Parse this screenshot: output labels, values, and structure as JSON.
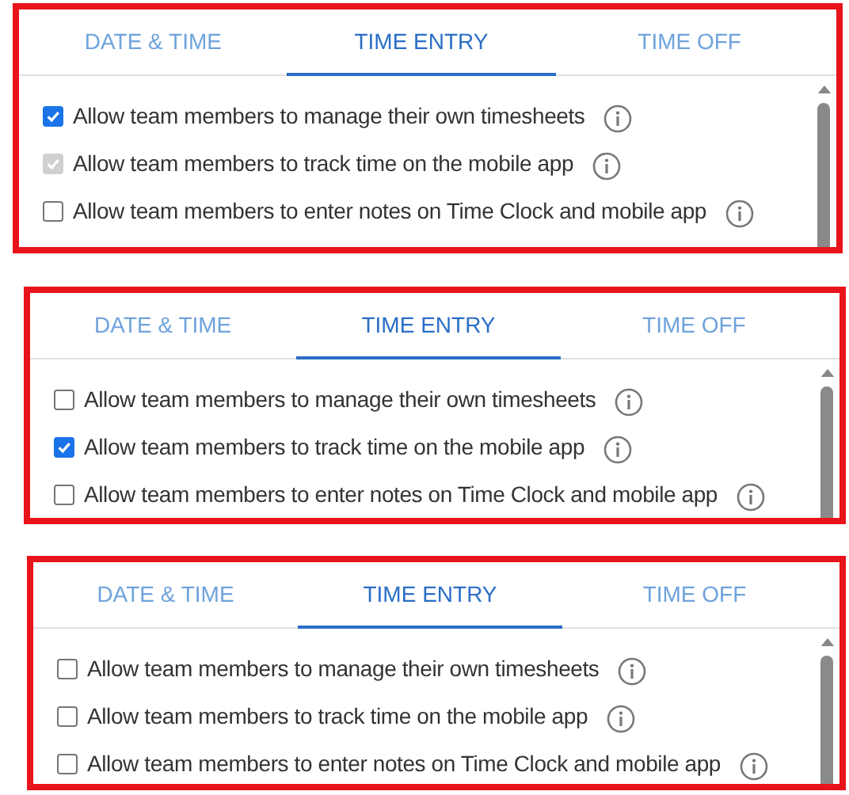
{
  "panels": [
    {
      "tabs": [
        {
          "label": "DATE & TIME",
          "selected": false
        },
        {
          "label": "TIME ENTRY",
          "selected": true
        },
        {
          "label": "TIME OFF",
          "selected": false
        }
      ],
      "options": [
        {
          "label": "Allow team members to manage their own timesheets",
          "checked": true,
          "disabled": false
        },
        {
          "label": "Allow team members to track time on the mobile app",
          "checked": true,
          "disabled": true
        },
        {
          "label": "Allow team members to enter notes on Time Clock and mobile app",
          "checked": false,
          "disabled": false
        }
      ]
    },
    {
      "tabs": [
        {
          "label": "DATE & TIME",
          "selected": false
        },
        {
          "label": "TIME ENTRY",
          "selected": true
        },
        {
          "label": "TIME OFF",
          "selected": false
        }
      ],
      "options": [
        {
          "label": "Allow team members to manage their own timesheets",
          "checked": false,
          "disabled": false
        },
        {
          "label": "Allow team members to track time on the mobile app",
          "checked": true,
          "disabled": false
        },
        {
          "label": "Allow team members to enter notes on Time Clock and mobile app",
          "checked": false,
          "disabled": false
        }
      ]
    },
    {
      "tabs": [
        {
          "label": "DATE & TIME",
          "selected": false
        },
        {
          "label": "TIME ENTRY",
          "selected": true
        },
        {
          "label": "TIME OFF",
          "selected": false
        }
      ],
      "options": [
        {
          "label": "Allow team members to manage their own timesheets",
          "checked": false,
          "disabled": false
        },
        {
          "label": "Allow team members to track time on the mobile app",
          "checked": false,
          "disabled": false
        },
        {
          "label": "Allow team members to enter notes on Time Clock and mobile app",
          "checked": false,
          "disabled": false
        }
      ]
    }
  ]
}
